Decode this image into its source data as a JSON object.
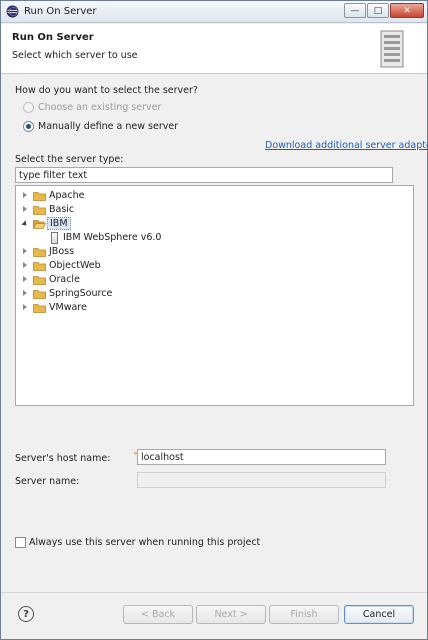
{
  "window": {
    "title": "Run On Server",
    "min_glyph": "—",
    "max_glyph": "□",
    "close_glyph": "✕"
  },
  "banner": {
    "title": "Run On Server",
    "subtitle": "Select which server to use"
  },
  "selection": {
    "question": "How do you want to select the server?",
    "options": [
      {
        "label": "Choose an existing server",
        "enabled": false,
        "checked": false
      },
      {
        "label": "Manually define a new server",
        "enabled": true,
        "checked": true
      }
    ]
  },
  "download_link": "Download additional server adapters",
  "server_type": {
    "label": "Select the server type:",
    "filter_value": "type filter text"
  },
  "tree": {
    "items": [
      {
        "label": "Apache",
        "expanded": false,
        "selected": false
      },
      {
        "label": "Basic",
        "expanded": false,
        "selected": false
      },
      {
        "label": "IBM",
        "expanded": true,
        "selected": true
      },
      {
        "label": "IBM WebSphere v6.0",
        "child": true
      },
      {
        "label": "JBoss",
        "expanded": false,
        "selected": false
      },
      {
        "label": "ObjectWeb",
        "expanded": false,
        "selected": false
      },
      {
        "label": "Oracle",
        "expanded": false,
        "selected": false
      },
      {
        "label": "SpringSource",
        "expanded": false,
        "selected": false
      },
      {
        "label": "VMware",
        "expanded": false,
        "selected": false
      }
    ]
  },
  "host": {
    "label": "Server's host name:",
    "value": "localhost"
  },
  "server_name": {
    "label": "Server name:",
    "value": ""
  },
  "always_use": {
    "label": "Always use this server when running this project",
    "checked": false
  },
  "buttons": {
    "help": "?",
    "back": "< Back",
    "next": "Next >",
    "finish": "Finish",
    "cancel": "Cancel"
  },
  "colors": {
    "link": "#1f5fb8",
    "folder": "#e8b84a",
    "selection": "#dbe7f6"
  }
}
